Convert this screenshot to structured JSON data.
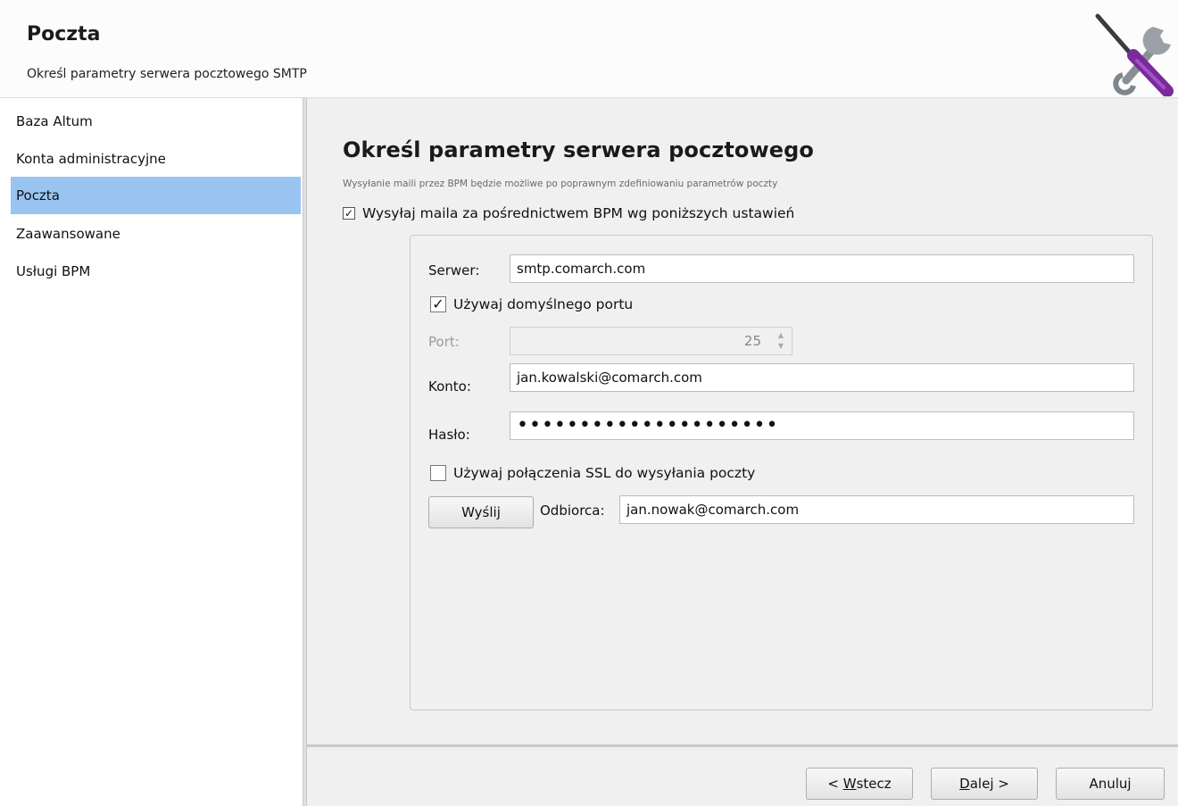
{
  "header": {
    "title": "Poczta",
    "subtitle": "Określ parametry serwera pocztowego SMTP",
    "icon": "wrench-screwdriver-icon"
  },
  "sidebar": {
    "items": [
      {
        "label": "Baza Altum",
        "selected": false
      },
      {
        "label": "Konta administracyjne",
        "selected": false
      },
      {
        "label": "Poczta",
        "selected": true
      },
      {
        "label": "Zaawansowane",
        "selected": false
      },
      {
        "label": "Usługi BPM",
        "selected": false
      }
    ]
  },
  "main": {
    "title": "Określ parametry serwera pocztowego",
    "description": "Wysyłanie maili przez BPM będzie możliwe po poprawnym zdefiniowaniu parametrów poczty",
    "send_via_bpm": {
      "label": "Wysyłaj maila za pośrednictwem BPM wg poniższych ustawień",
      "checked": true
    }
  },
  "form": {
    "server": {
      "label": "Serwer:",
      "value": "smtp.comarch.com"
    },
    "default_port": {
      "label": "Używaj domyślnego portu",
      "checked": true
    },
    "port": {
      "label": "Port:",
      "value": "25",
      "disabled": true
    },
    "account": {
      "label": "Konto:",
      "value": "jan.kowalski@comarch.com"
    },
    "password": {
      "label": "Hasło:",
      "value": "•••••••••••••••••••••"
    },
    "ssl": {
      "label": "Używaj połączenia SSL do wysyłania poczty",
      "checked": false
    },
    "send_button": "Wyślij",
    "recipient": {
      "label": "Odbiorca:",
      "value": "jan.nowak@comarch.com"
    }
  },
  "footer": {
    "back": {
      "prefix": "< ",
      "mnemonic": "W",
      "rest": "stecz"
    },
    "next": {
      "mnemonic": "D",
      "rest": "alej >"
    },
    "cancel": "Anuluj"
  },
  "colors": {
    "selection": "#99c4f2",
    "background": "#f0f0f0"
  }
}
